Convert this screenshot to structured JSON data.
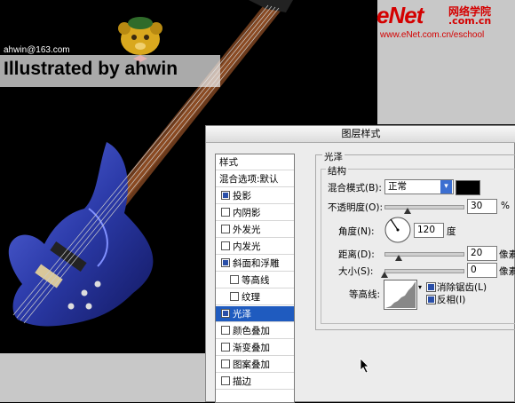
{
  "canvas": {
    "credit": "Illustrated by ahwin",
    "email": "ahwin@163.com",
    "logo": {
      "main": "eNet",
      "cn": "网络学院",
      "com": ".com.cn",
      "url": "www.eNet.com.cn/eschool"
    }
  },
  "dialog": {
    "title": "图层样式",
    "style_list": [
      {
        "label": "样式",
        "type": "head"
      },
      {
        "label": "混合选项:默认",
        "type": "head"
      },
      {
        "label": "投影",
        "checked": true
      },
      {
        "label": "内阴影",
        "checked": false
      },
      {
        "label": "外发光",
        "checked": false
      },
      {
        "label": "内发光",
        "checked": false
      },
      {
        "label": "斜面和浮雕",
        "checked": true
      },
      {
        "label": "等高线",
        "checked": false,
        "sub": true
      },
      {
        "label": "纹理",
        "checked": false,
        "sub": true
      },
      {
        "label": "光泽",
        "checked": true,
        "selected": true
      },
      {
        "label": "颜色叠加",
        "checked": false
      },
      {
        "label": "渐变叠加",
        "checked": false
      },
      {
        "label": "图案叠加",
        "checked": false
      },
      {
        "label": "描边",
        "checked": false
      }
    ],
    "section": "光泽",
    "group": "结构",
    "blend_mode": {
      "label": "混合模式(B):",
      "value": "正常",
      "swatch_color": "#000000"
    },
    "opacity": {
      "label": "不透明度(O):",
      "value": "30",
      "unit": "%",
      "level": 30
    },
    "angle": {
      "label": "角度(N):",
      "value": "120",
      "unit": "度"
    },
    "distance": {
      "label": "距离(D):",
      "value": "20",
      "unit": "像素",
      "level": 20
    },
    "size": {
      "label": "大小(S):",
      "value": "0",
      "unit": "像素",
      "level": 0
    },
    "contour": {
      "label": "等高线:"
    },
    "anti_alias": {
      "label": "消除锯齿(L)",
      "checked": true
    },
    "invert": {
      "label": "反相(I)",
      "checked": true
    }
  },
  "colors": {
    "selection": "#1f5bbf",
    "logo_red": "#d40000",
    "guitar_blue": "#2b3aa8"
  }
}
